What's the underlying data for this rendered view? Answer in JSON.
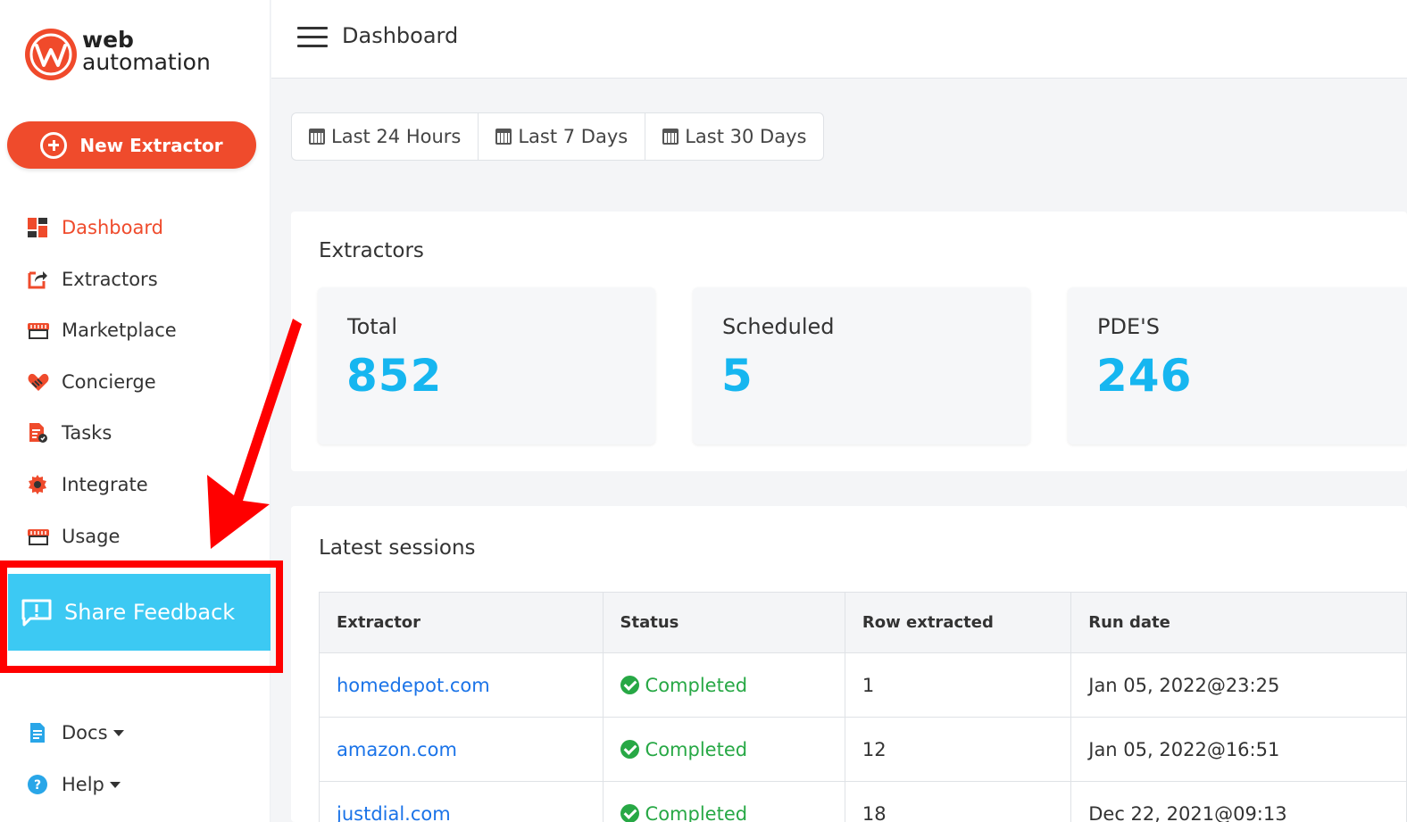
{
  "brand": {
    "line1": "web",
    "line2": "automation",
    "accent": "#ef4b2c"
  },
  "sidebar": {
    "new_extractor": "New Extractor",
    "items": [
      {
        "label": "Dashboard",
        "icon": "dashboard-icon",
        "active": true
      },
      {
        "label": "Extractors",
        "icon": "export-icon"
      },
      {
        "label": "Marketplace",
        "icon": "store-icon"
      },
      {
        "label": "Concierge",
        "icon": "heart-handshake-icon"
      },
      {
        "label": "Tasks",
        "icon": "tasks-icon"
      },
      {
        "label": "Integrate",
        "icon": "gear-icon"
      },
      {
        "label": "Usage",
        "icon": "store-icon"
      }
    ],
    "feedback": "Share Feedback",
    "docs": "Docs",
    "help": "Help"
  },
  "header": {
    "title": "Dashboard"
  },
  "ranges": [
    "Last 24 Hours",
    "Last 7 Days",
    "Last 30 Days"
  ],
  "extractors": {
    "title": "Extractors",
    "stats": [
      {
        "label": "Total",
        "value": "852"
      },
      {
        "label": "Scheduled",
        "value": "5"
      },
      {
        "label": "PDE'S",
        "value": "246"
      }
    ]
  },
  "sessions": {
    "title": "Latest sessions",
    "columns": [
      "Extractor",
      "Status",
      "Row extracted",
      "Run date"
    ],
    "rows": [
      {
        "extractor": "homedepot.com",
        "status": "Completed",
        "rows": "1",
        "date": "Jan 05, 2022@23:25"
      },
      {
        "extractor": "amazon.com",
        "status": "Completed",
        "rows": "12",
        "date": "Jan 05, 2022@16:51"
      },
      {
        "extractor": "justdial.com",
        "status": "Completed",
        "rows": "18",
        "date": "Dec 22, 2021@09:13"
      }
    ]
  },
  "colors": {
    "stat_value": "#16b6f0",
    "feedback_bg": "#3cc9f3",
    "highlight": "#ff0000",
    "status_ok": "#27a845",
    "link": "#1a73e8"
  }
}
